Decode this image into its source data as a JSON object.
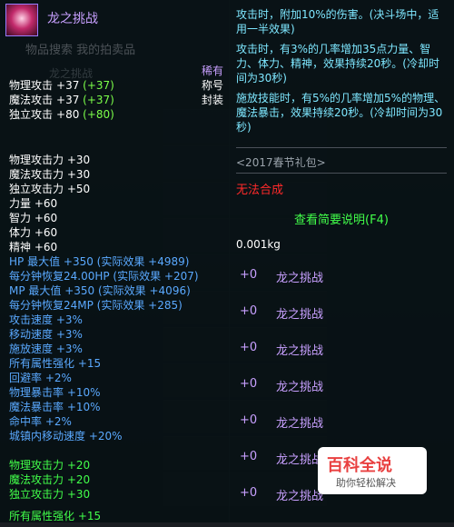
{
  "item": {
    "name": "龙之挑战",
    "search_placeholder": "物品搜索 我的拍卖品",
    "ghost_title": "龙之挑战"
  },
  "side_stats": {
    "rarity": "稀有",
    "title_label": "称号",
    "sealed": "封装"
  },
  "stats_top": [
    {
      "label": "物理攻击",
      "value": "+37",
      "bonus": "(+37)"
    },
    {
      "label": "魔法攻击",
      "value": "+37",
      "bonus": "(+37)"
    },
    {
      "label": "独立攻击",
      "value": "+80",
      "bonus": "(+80)"
    }
  ],
  "stats_main": [
    "物理攻击力 +30",
    "魔法攻击力 +30",
    "独立攻击力 +50",
    "力量 +60",
    "智力 +60",
    "体力 +60",
    "精神 +60"
  ],
  "stats_blue": [
    "HP 最大值 +350 (实际效果 +4989)",
    "每分钟恢复24.00HP (实际效果 +207)",
    "MP 最大值 +350 (实际效果 +4096)",
    "每分钟恢复24MP (实际效果 +285)",
    "攻击速度 +3%",
    "移动速度 +3%",
    "施放速度 +3%",
    "所有属性强化 +15",
    "回避率 +2%",
    "物理暴击率 +10%",
    "魔法暴击率 +10%",
    "命中率 +2%",
    "城镇内移动速度 +20%"
  ],
  "stats_bottom": [
    "物理攻击力 +20",
    "魔法攻击力 +20",
    "独立攻击力 +30",
    "所有属性强化 +15"
  ],
  "desc": {
    "line1": "攻击时，附加10%的伤害。(决斗场中，适用一半效果)",
    "line2": "攻击时，有3%的几率增加35点力量、智力、体力、精神，效果持续20秒。(冷却时间为30秒)",
    "line3": "施放技能时，有5%的几率增加5%的物理、魔法暴击，效果持续20秒。(冷却时间为30秒)"
  },
  "package": "<2017春节礼包>",
  "no_fusion": "无法合成",
  "view_button": "查看简要说明(F4)",
  "weight": "0.001kg",
  "list": [
    {
      "plus": "+0",
      "name": "龙之挑战"
    },
    {
      "plus": "+0",
      "name": "龙之挑战"
    },
    {
      "plus": "+0",
      "name": "龙之挑战"
    },
    {
      "plus": "+0",
      "name": "龙之挑战"
    },
    {
      "plus": "+0",
      "name": "龙之挑战"
    },
    {
      "plus": "+0",
      "name": "龙之挑战"
    },
    {
      "plus": "+0",
      "name": "龙之挑战"
    }
  ],
  "watermark": {
    "brand": "百科全说",
    "sub": "助你轻松解决"
  },
  "colors": {
    "item_purple": "#c8a0ff",
    "stat_green": "#7cff4a",
    "stat_blue": "#5aa9ff",
    "desc_cyan": "#7ee7ff",
    "warn_red": "#ff2a2a"
  }
}
